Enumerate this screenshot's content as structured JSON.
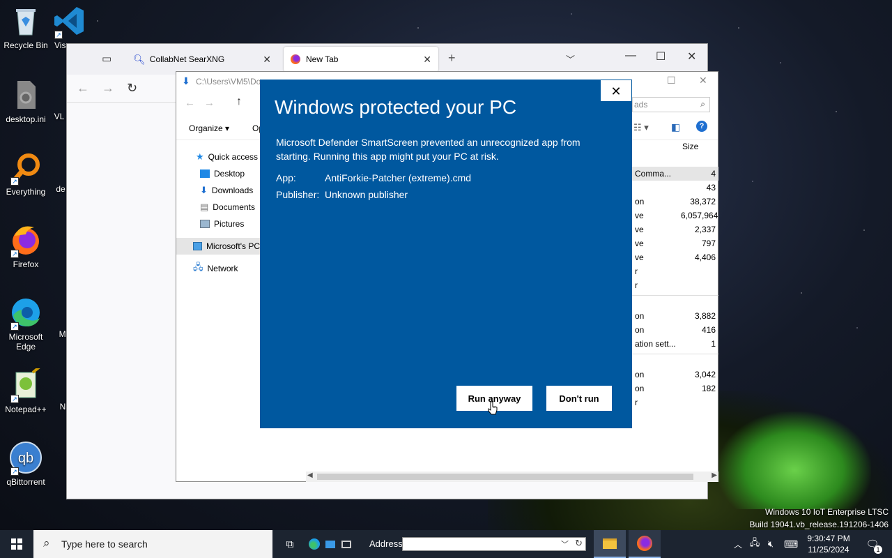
{
  "desktop": {
    "icons": [
      {
        "label": "Recycle Bin"
      },
      {
        "label": "desktop.ini"
      },
      {
        "label": "Everything"
      },
      {
        "label": "Firefox"
      },
      {
        "label": "Microsoft Edge"
      },
      {
        "label": "Notepad++"
      },
      {
        "label": "qBittorrent"
      }
    ],
    "partial_labels": [
      "Vis",
      "VL",
      "de",
      "Mi",
      "N"
    ]
  },
  "browser": {
    "tabs": [
      {
        "label": "CollabNet SearXNG",
        "active": false
      },
      {
        "label": "New Tab",
        "active": true
      }
    ]
  },
  "explorer": {
    "path": "C:\\Users\\VM5\\Do",
    "search_placeholder": "ads",
    "organize_label": "Organize",
    "open_label": "Op",
    "size_header": "Size",
    "nav": [
      {
        "label": "Quick access",
        "icon": "star-icon"
      },
      {
        "label": "Desktop",
        "icon": "desktop-folder-icon"
      },
      {
        "label": "Downloads",
        "icon": "download-icon"
      },
      {
        "label": "Documents",
        "icon": "document-icon"
      },
      {
        "label": "Pictures",
        "icon": "picture-icon"
      },
      {
        "label": "Microsoft's PC",
        "icon": "pc-icon"
      },
      {
        "label": "Network",
        "icon": "network-icon"
      }
    ],
    "rows": [
      {
        "type": "Comma...",
        "size": "4"
      },
      {
        "type": "",
        "size": "43"
      },
      {
        "type": "on",
        "size": "38,372"
      },
      {
        "type": "ve",
        "size": "6,057,964"
      },
      {
        "type": "ve",
        "size": "2,337"
      },
      {
        "type": "ve",
        "size": "797"
      },
      {
        "type": "ve",
        "size": "4,406"
      },
      {
        "type": "r",
        "size": ""
      },
      {
        "type": "r",
        "size": ""
      },
      {
        "type": "",
        "size": ""
      },
      {
        "type": "on",
        "size": "3,882"
      },
      {
        "type": "on",
        "size": "416"
      },
      {
        "type": "ation sett...",
        "size": "1"
      },
      {
        "type": "",
        "size": ""
      },
      {
        "type": "on",
        "size": "3,042"
      },
      {
        "type": "on",
        "size": "182"
      },
      {
        "type": "r",
        "size": ""
      }
    ]
  },
  "dialog": {
    "title": "Windows protected your PC",
    "message": "Microsoft Defender SmartScreen prevented an unrecognized app from starting. Running this app might put your PC at risk.",
    "app_label": "App:",
    "app_value": "AntiForkie-Patcher (extreme).cmd",
    "publisher_label": "Publisher:",
    "publisher_value": "Unknown publisher",
    "run_anyway": "Run anyway",
    "dont_run": "Don't run",
    "accent": "#00589f"
  },
  "taskbar": {
    "search_placeholder": "Type here to search",
    "address_label": "Address",
    "time": "9:30:47 PM",
    "date": "11/25/2024",
    "notification_count": "1"
  },
  "watermark": {
    "line1": "Windows 10 IoT Enterprise LTSC",
    "line2": "Build 19041.vb_release.191206-1406"
  }
}
